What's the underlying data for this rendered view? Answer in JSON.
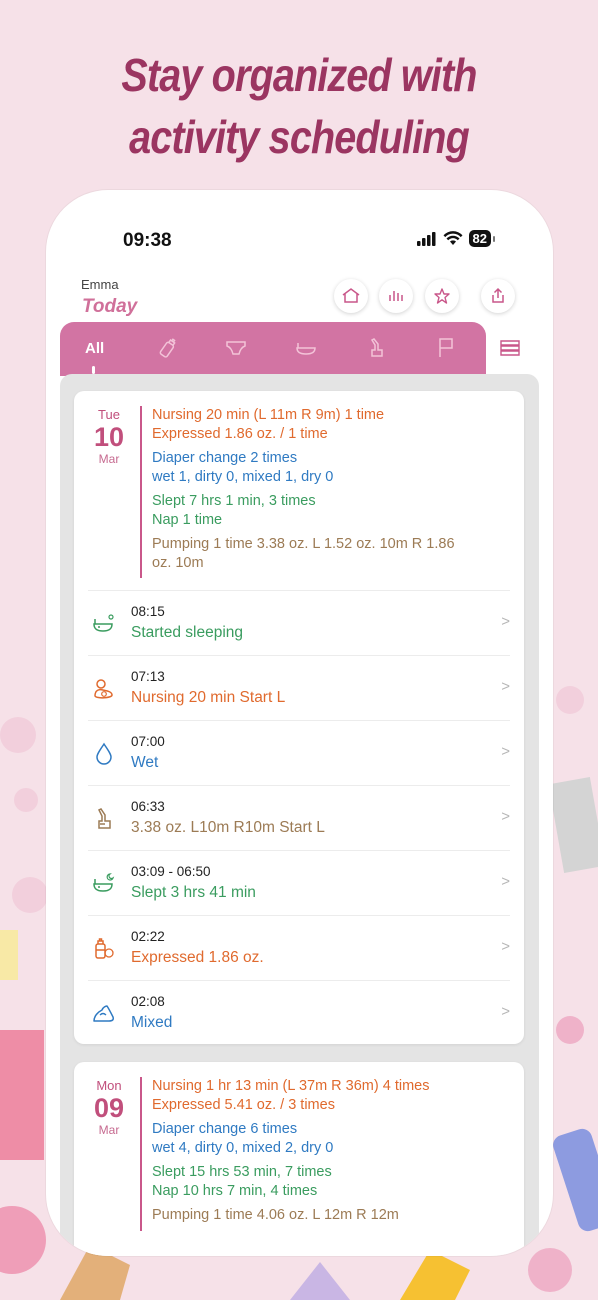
{
  "headline": [
    "Stay organized with",
    "activity scheduling"
  ],
  "status_bar": {
    "time": "09:38",
    "battery": "82"
  },
  "header": {
    "user_name": "Emma",
    "title": "Today"
  },
  "toolbar_icons": [
    "home-icon",
    "chart-icon",
    "star-icon",
    "share-icon"
  ],
  "tabs": [
    {
      "label": "All",
      "icon": null
    },
    {
      "label": "",
      "icon": "bottle-icon"
    },
    {
      "label": "",
      "icon": "diaper-icon"
    },
    {
      "label": "",
      "icon": "sleep-icon"
    },
    {
      "label": "",
      "icon": "pump-icon"
    },
    {
      "label": "",
      "icon": "flag-icon"
    }
  ],
  "day1": {
    "dow": "Tue",
    "day": "10",
    "month": "Mar",
    "summary": {
      "feeding": [
        "Nursing 20 min (L 11m  R 9m)  1 time",
        "Expressed 1.86 oz. / 1 time"
      ],
      "diaper": [
        "Diaper change 2 times",
        "wet 1,  dirty 0,  mixed 1,  dry 0"
      ],
      "sleep": [
        "Slept 7 hrs 1 min, 3 times",
        "Nap 1 time"
      ],
      "pumping": [
        "Pumping 1 time 3.38 oz. L 1.52 oz.  10m R 1.86",
        "oz.  10m"
      ]
    },
    "events": [
      {
        "time": "08:15",
        "text": "Started sleeping",
        "icon": "crib-sleep-icon",
        "color": "#3a9c5f"
      },
      {
        "time": "07:13",
        "text": "Nursing  20 min Start L",
        "icon": "nursing-icon",
        "color": "#e06a2e"
      },
      {
        "time": "07:00",
        "text": "Wet",
        "icon": "drop-icon",
        "color": "#2f7ac2"
      },
      {
        "time": "06:33",
        "text": "3.38 oz. L10m R10m  Start L",
        "icon": "pump-icon",
        "color": "#9c7b55"
      },
      {
        "time": "03:09 - 06:50",
        "text": "Slept 3 hrs 41 min",
        "icon": "crib-moon-icon",
        "color": "#3a9c5f"
      },
      {
        "time": "02:22",
        "text": "Expressed 1.86 oz.",
        "icon": "bottle-icon",
        "color": "#e06a2e"
      },
      {
        "time": "02:08",
        "text": "Mixed",
        "icon": "poop-icon",
        "color": "#2f7ac2"
      }
    ]
  },
  "day2": {
    "dow": "Mon",
    "day": "09",
    "month": "Mar",
    "summary": {
      "feeding": [
        "Nursing 1 hr 13 min (L 37m  R 36m)  4 times",
        "Expressed 5.41 oz. / 3 times"
      ],
      "diaper": [
        "Diaper change 6 times",
        "wet 4,  dirty 0,  mixed 2,  dry 0"
      ],
      "sleep": [
        "Slept 15 hrs 53 min, 7 times",
        "Nap 10 hrs 7 min, 4 times"
      ],
      "pumping": [
        "Pumping 1 time 4.06 oz. L 12m R 12m"
      ]
    }
  }
}
